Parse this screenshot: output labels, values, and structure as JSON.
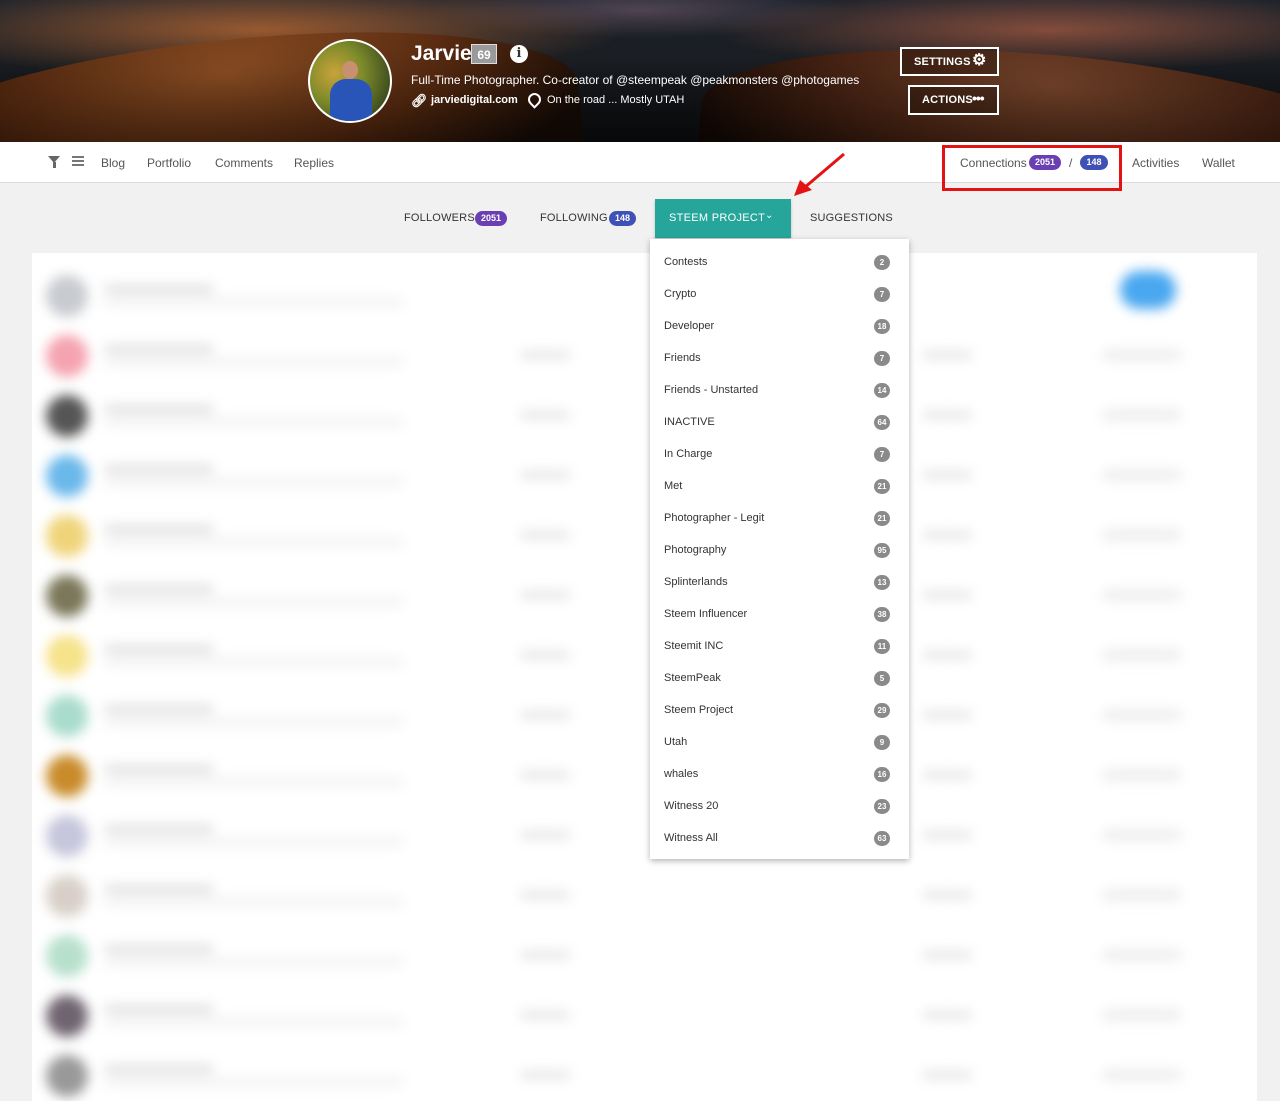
{
  "profile": {
    "name": "Jarvie",
    "reputation": "69",
    "info_icon": "info-icon",
    "bio": "Full-Time Photographer. Co-creator of @steempeak @peakmonsters @photogames",
    "website": "jarviedigital.com",
    "location": "On the road ... Mostly UTAH"
  },
  "header_buttons": {
    "settings": "SETTINGS",
    "actions": "ACTIONS"
  },
  "nav": {
    "items": [
      "Blog",
      "Portfolio",
      "Comments",
      "Replies"
    ],
    "connections_label": "Connections",
    "connections_followers": "2051",
    "connections_separator": "/",
    "connections_following": "148",
    "activities": "Activities",
    "wallet": "Wallet"
  },
  "tabs": {
    "followers_label": "FOLLOWERS",
    "followers_count": "2051",
    "following_label": "FOLLOWING",
    "following_count": "148",
    "active_label": "STEEM PROJECT",
    "suggestions_label": "SUGGESTIONS"
  },
  "dropdown": {
    "items": [
      {
        "label": "Contests",
        "count": "2"
      },
      {
        "label": "Crypto",
        "count": "7"
      },
      {
        "label": "Developer",
        "count": "18"
      },
      {
        "label": "Friends",
        "count": "7"
      },
      {
        "label": "Friends - Unstarted",
        "count": "14"
      },
      {
        "label": "INACTIVE",
        "count": "64"
      },
      {
        "label": "In Charge",
        "count": "7"
      },
      {
        "label": "Met",
        "count": "21"
      },
      {
        "label": "Photographer - Legit",
        "count": "21"
      },
      {
        "label": "Photography",
        "count": "95"
      },
      {
        "label": "Splinterlands",
        "count": "13"
      },
      {
        "label": "Steem Influencer",
        "count": "38"
      },
      {
        "label": "Steemit INC",
        "count": "11"
      },
      {
        "label": "SteemPeak",
        "count": "5"
      },
      {
        "label": "Steem Project",
        "count": "29"
      },
      {
        "label": "Utah",
        "count": "9"
      },
      {
        "label": "whales",
        "count": "16"
      },
      {
        "label": "Witness 20",
        "count": "23"
      },
      {
        "label": "Witness All",
        "count": "63"
      }
    ]
  },
  "colors": {
    "accent_teal": "#26a69a",
    "followers_purple": "#6a3fb3",
    "following_indigo": "#3f51b5",
    "highlight_red": "#e31313"
  }
}
